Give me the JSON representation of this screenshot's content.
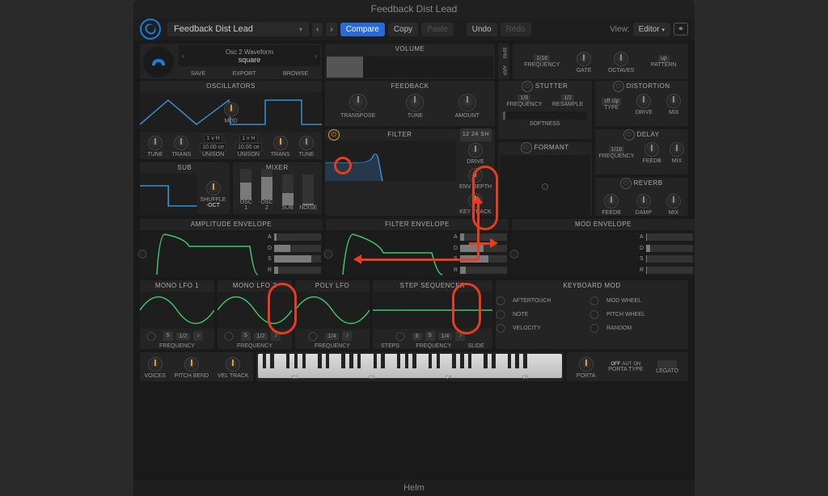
{
  "window": {
    "title": "Feedback Dist Lead"
  },
  "toolbar": {
    "preset": "Feedback Dist Lead",
    "prev": "‹",
    "next": "›",
    "compare": "Compare",
    "copy": "Copy",
    "paste": "Paste",
    "undo": "Undo",
    "redo": "Redo",
    "view_label": "View:",
    "view_value": "Editor"
  },
  "patch": {
    "osc2_wave_label": "Osc 2 Waveform",
    "osc2_wave_value": "square",
    "save": "SAVE",
    "export": "EXPORT",
    "browse": "BROWSE"
  },
  "top_right": {
    "bpm": "BPM",
    "arp": "ARP",
    "freq_div": "1/16",
    "frequency": "FREQUENCY",
    "gate": "GATE",
    "octaves": "OCTAVES",
    "pattern": "PATTERN",
    "pattern_val": "up"
  },
  "volume": {
    "label": "VOLUME"
  },
  "osc": {
    "title": "OSCILLATORS",
    "mod": "MOD",
    "tune": "TUNE",
    "trans": "TRANS",
    "unison": "UNISON",
    "unison_v1": "1 v H",
    "unison_v2": "10.00 ce"
  },
  "feedback": {
    "title": "FEEDBACK",
    "transpose": "TRANSPOSE",
    "tune": "TUNE",
    "amount": "AMOUNT"
  },
  "filter": {
    "title": "FILTER",
    "slope": "12 24 SH",
    "drive": "DRIVE",
    "env_depth": "ENV DEPTH",
    "key_track": "KEY TRACK"
  },
  "stutter": {
    "title": "STUTTER",
    "freq": "FREQUENCY",
    "resample": "RESAMPLE",
    "softness": "SOFTNESS",
    "v1": "1/8",
    "v2": "1/2"
  },
  "formant": {
    "title": "FORMANT"
  },
  "distortion": {
    "title": "DISTORTION",
    "type": "TYPE",
    "type_val": "sft clp",
    "drive": "DRIVE",
    "mix": "MIX"
  },
  "delay": {
    "title": "DELAY",
    "freq": "FREQUENCY",
    "freq_val": "1/16",
    "feedb": "FEEDB",
    "mix": "MIX"
  },
  "reverb": {
    "title": "REVERB",
    "feedb": "FEEDB",
    "damp": "DAMP",
    "mix": "MIX"
  },
  "sub": {
    "title": "SUB",
    "shuffle": "SHUFFLE",
    "oct": "-OCT"
  },
  "mixer": {
    "title": "MIXER",
    "osc1": "OSC 1",
    "osc2": "OSC 2",
    "sub": "SUB",
    "noise": "NOISE"
  },
  "env": {
    "amp": "AMPLITUDE ENVELOPE",
    "fil": "FILTER ENVELOPE",
    "mod": "MOD ENVELOPE",
    "a": "A",
    "d": "D",
    "s": "S",
    "r": "R"
  },
  "lfo": {
    "mono1": "MONO LFO 1",
    "mono2": "MONO LFO 2",
    "poly": "POLY LFO",
    "seq": "STEP SEQUENCER",
    "freq": "FREQUENCY",
    "steps": "STEPS",
    "slide": "SLIDE",
    "v12": "1/2",
    "v14": "1/4",
    "steps_n": "8"
  },
  "kbmod": {
    "title": "KEYBOARD MOD",
    "aftertouch": "AFTERTOUCH",
    "modwheel": "MOD WHEEL",
    "note": "NOTE",
    "pitchwheel": "PITCH WHEEL",
    "velocity": "VELOCITY",
    "random": "RANDOM"
  },
  "bottom": {
    "voices": "VOICES",
    "pitchbend": "PITCH BEND",
    "veltrack": "VEL TRACK",
    "porta": "PORTA",
    "portatype": "PORTA TYPE",
    "legato": "LEGATO",
    "off": "OFF",
    "aut": "AUT",
    "on": "ON",
    "c2": "C2",
    "c3": "C3",
    "c4": "C4",
    "c5": "C5"
  },
  "footer": "Helm",
  "chart_data": [
    {
      "type": "line",
      "title": "Amplitude Envelope",
      "adsr": {
        "A": 0.02,
        "D": 0.25,
        "S": 0.7,
        "R": 0.05
      }
    },
    {
      "type": "line",
      "title": "Filter Envelope",
      "adsr": {
        "A": 0.05,
        "D": 0.35,
        "S": 0.55,
        "R": 0.1
      }
    },
    {
      "type": "line",
      "title": "Mod Envelope",
      "adsr": {
        "A": 0.0,
        "D": 0.05,
        "S": 0.0,
        "R": 0.0
      }
    }
  ]
}
